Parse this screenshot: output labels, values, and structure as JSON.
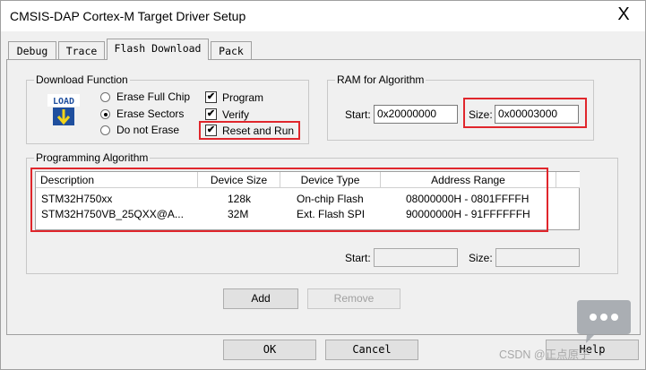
{
  "window": {
    "title": "CMSIS-DAP Cortex-M Target Driver Setup",
    "close_glyph": "X"
  },
  "tabs": [
    {
      "label": "Debug",
      "active": false
    },
    {
      "label": "Trace",
      "active": false
    },
    {
      "label": "Flash Download",
      "active": true
    },
    {
      "label": "Pack",
      "active": false
    }
  ],
  "download_function": {
    "label": "Download Function",
    "icon_text": "LOAD",
    "radios": [
      {
        "label": "Erase Full Chip",
        "selected": false
      },
      {
        "label": "Erase Sectors",
        "selected": true
      },
      {
        "label": "Do not Erase",
        "selected": false
      }
    ],
    "checkboxes": [
      {
        "label": "Program",
        "checked": true
      },
      {
        "label": "Verify",
        "checked": true
      },
      {
        "label": "Reset and Run",
        "checked": true
      }
    ],
    "check_glyph": "✔"
  },
  "ram": {
    "label": "RAM for Algorithm",
    "start_label": "Start:",
    "start_value": "0x20000000",
    "size_label": "Size:",
    "size_value": "0x00003000"
  },
  "programming_algorithm": {
    "label": "Programming Algorithm",
    "columns": [
      "Description",
      "Device Size",
      "Device Type",
      "Address Range"
    ],
    "rows": [
      {
        "description": "STM32H750xx",
        "size": "128k",
        "type": "On-chip Flash",
        "range": "08000000H - 0801FFFFH"
      },
      {
        "description": "STM32H750VB_25QXX@A...",
        "size": "32M",
        "type": "Ext. Flash SPI",
        "range": "90000000H - 91FFFFFFH"
      }
    ],
    "start_label": "Start:",
    "start_value": "",
    "size_label": "Size:",
    "size_value": "",
    "add_label": "Add",
    "remove_label": "Remove"
  },
  "footer": {
    "ok_label": "OK",
    "cancel_label": "Cancel",
    "help_label": "Help"
  },
  "watermark": "CSDN @正点原子",
  "colors": {
    "highlight_box": "#e0262c",
    "dialog_bg": "#f0f0f0",
    "load_icon": "#1f4f9e"
  }
}
